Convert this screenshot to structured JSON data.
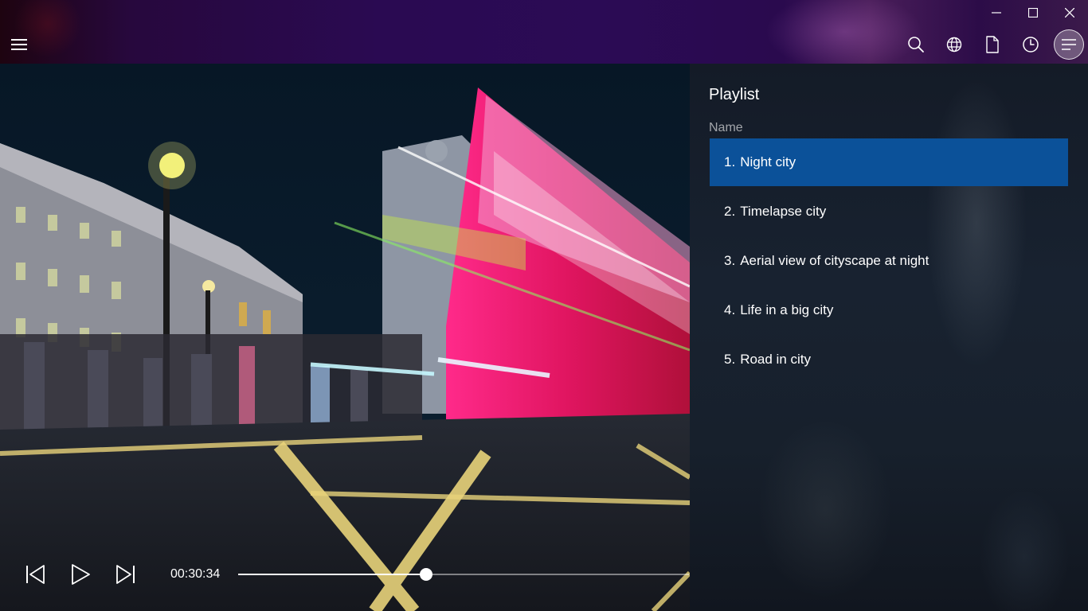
{
  "window": {
    "minimize_label": "Minimize",
    "maximize_label": "Maximize",
    "close_label": "Close"
  },
  "toolbar": {
    "menu_icon": "hamburger-icon",
    "search_icon": "search-icon",
    "globe_icon": "globe-icon",
    "file_icon": "file-icon",
    "clock_icon": "clock-icon",
    "playlist_icon": "playlist-menu-icon"
  },
  "player": {
    "current_time": "00:30:34",
    "progress": 0.417,
    "prev_icon": "skip-previous-icon",
    "play_icon": "play-icon",
    "next_icon": "skip-next-icon"
  },
  "playlist": {
    "title": "Playlist",
    "column_header": "Name",
    "selected_index": 0,
    "accent_color": "#0b5199",
    "items": [
      {
        "number": "1.",
        "name": "Night city"
      },
      {
        "number": "2.",
        "name": "Timelapse city"
      },
      {
        "number": "3.",
        "name": "Aerial view of cityscape at night"
      },
      {
        "number": "4.",
        "name": "Life in a big city"
      },
      {
        "number": "5.",
        "name": "Road in city"
      }
    ]
  }
}
